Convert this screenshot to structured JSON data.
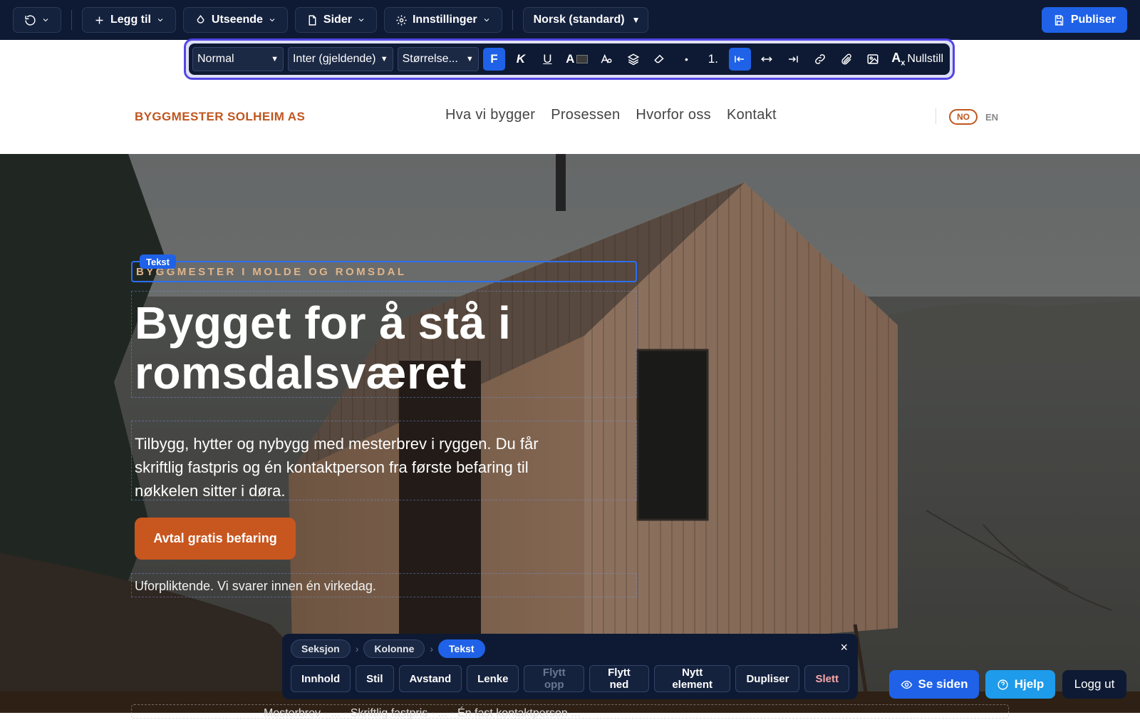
{
  "editor_toolbar": {
    "add_label": "Legg til",
    "appearance_label": "Utseende",
    "pages_label": "Sider",
    "settings_label": "Innstillinger",
    "language_select": "Norsk (standard)",
    "publish_label": "Publiser"
  },
  "text_toolbar": {
    "block_style": "Normal",
    "font": "Inter (gjeldende)",
    "size": "Størrelse...",
    "bold": "F",
    "italic": "K",
    "underline": "U",
    "text_color": "A",
    "ordered_list": "1.",
    "clear_label": "Nullstill"
  },
  "site_header": {
    "logo": "BYGGMESTER SOLHEIM AS",
    "nav": [
      "Hva vi bygger",
      "Prosessen",
      "Hvorfor oss",
      "Kontakt"
    ],
    "lang_active": "NO",
    "lang_other": "EN"
  },
  "hero": {
    "selected_tag": "Tekst",
    "eyebrow": "BYGGMESTER I MOLDE OG ROMSDAL",
    "heading": "Bygget for å stå i romsdalsværet",
    "lead": "Tilbygg, hytter og nybygg med mesterbrev i ryggen. Du får skriftlig fastpris og én kontaktperson fra første befaring til nøkkelen sitter i døra.",
    "cta": "Avtal gratis befaring",
    "note": "Uforpliktende. Vi svarer innen én virkedag."
  },
  "bottom_strip_text": "Mesterbrev · ... · Skriftlig fastpris · ... · Én fast kontaktperson ...",
  "element_panel": {
    "crumbs": [
      "Seksjon",
      "Kolonne",
      "Tekst"
    ],
    "actions": [
      "Innhold",
      "Stil",
      "Avstand",
      "Lenke",
      "Flytt opp",
      "Flytt ned",
      "Nytt element",
      "Dupliser",
      "Slett"
    ]
  },
  "floating": {
    "view_label": "Se siden",
    "help_label": "Hjelp",
    "logout_label": "Logg ut"
  },
  "colors": {
    "editor_dark": "#0e1a33",
    "primary_blue": "#1f62e8",
    "brand_orange": "#c8561f",
    "focus_purple": "#5146e5"
  }
}
